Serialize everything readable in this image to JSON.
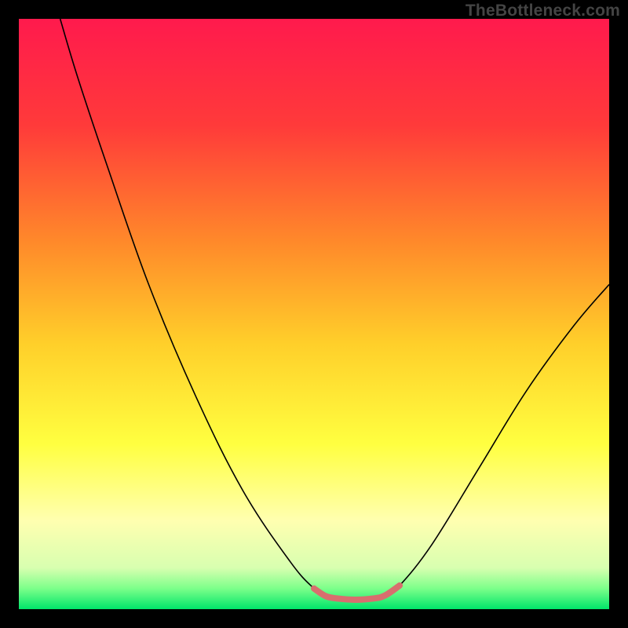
{
  "watermark": "TheBottleneck.com",
  "chart_data": {
    "type": "line",
    "title": "",
    "xlabel": "",
    "ylabel": "",
    "xlim": [
      0,
      100
    ],
    "ylim": [
      0,
      100
    ],
    "background_gradient": {
      "stops": [
        {
          "offset": 0.0,
          "color": "#ff1a4d"
        },
        {
          "offset": 0.18,
          "color": "#ff3a3a"
        },
        {
          "offset": 0.38,
          "color": "#ff8a2a"
        },
        {
          "offset": 0.55,
          "color": "#ffcf2a"
        },
        {
          "offset": 0.72,
          "color": "#ffff40"
        },
        {
          "offset": 0.85,
          "color": "#ffffb0"
        },
        {
          "offset": 0.93,
          "color": "#d8ffb0"
        },
        {
          "offset": 0.965,
          "color": "#7cff8a"
        },
        {
          "offset": 1.0,
          "color": "#00e56a"
        }
      ]
    },
    "series": [
      {
        "name": "main-curve",
        "color": "#000000",
        "width": 1.6,
        "points": [
          {
            "x": 7.0,
            "y": 100.0
          },
          {
            "x": 10.0,
            "y": 90.0
          },
          {
            "x": 15.0,
            "y": 75.0
          },
          {
            "x": 22.0,
            "y": 55.0
          },
          {
            "x": 30.0,
            "y": 36.0
          },
          {
            "x": 38.0,
            "y": 20.0
          },
          {
            "x": 46.0,
            "y": 8.0
          },
          {
            "x": 50.0,
            "y": 3.5
          },
          {
            "x": 52.0,
            "y": 2.2
          },
          {
            "x": 54.0,
            "y": 1.8
          },
          {
            "x": 57.0,
            "y": 1.6
          },
          {
            "x": 60.0,
            "y": 1.8
          },
          {
            "x": 62.0,
            "y": 2.3
          },
          {
            "x": 64.5,
            "y": 4.0
          },
          {
            "x": 70.0,
            "y": 11.0
          },
          {
            "x": 78.0,
            "y": 24.0
          },
          {
            "x": 86.0,
            "y": 37.0
          },
          {
            "x": 94.0,
            "y": 48.0
          },
          {
            "x": 100.0,
            "y": 55.0
          }
        ]
      },
      {
        "name": "highlight-segment",
        "color": "#d86e6e",
        "width": 8,
        "cap": "round",
        "points": [
          {
            "x": 50.0,
            "y": 3.5
          },
          {
            "x": 52.0,
            "y": 2.2
          },
          {
            "x": 54.0,
            "y": 1.8
          },
          {
            "x": 57.0,
            "y": 1.6
          },
          {
            "x": 60.0,
            "y": 1.8
          },
          {
            "x": 62.0,
            "y": 2.3
          },
          {
            "x": 64.5,
            "y": 4.0
          }
        ]
      }
    ]
  }
}
